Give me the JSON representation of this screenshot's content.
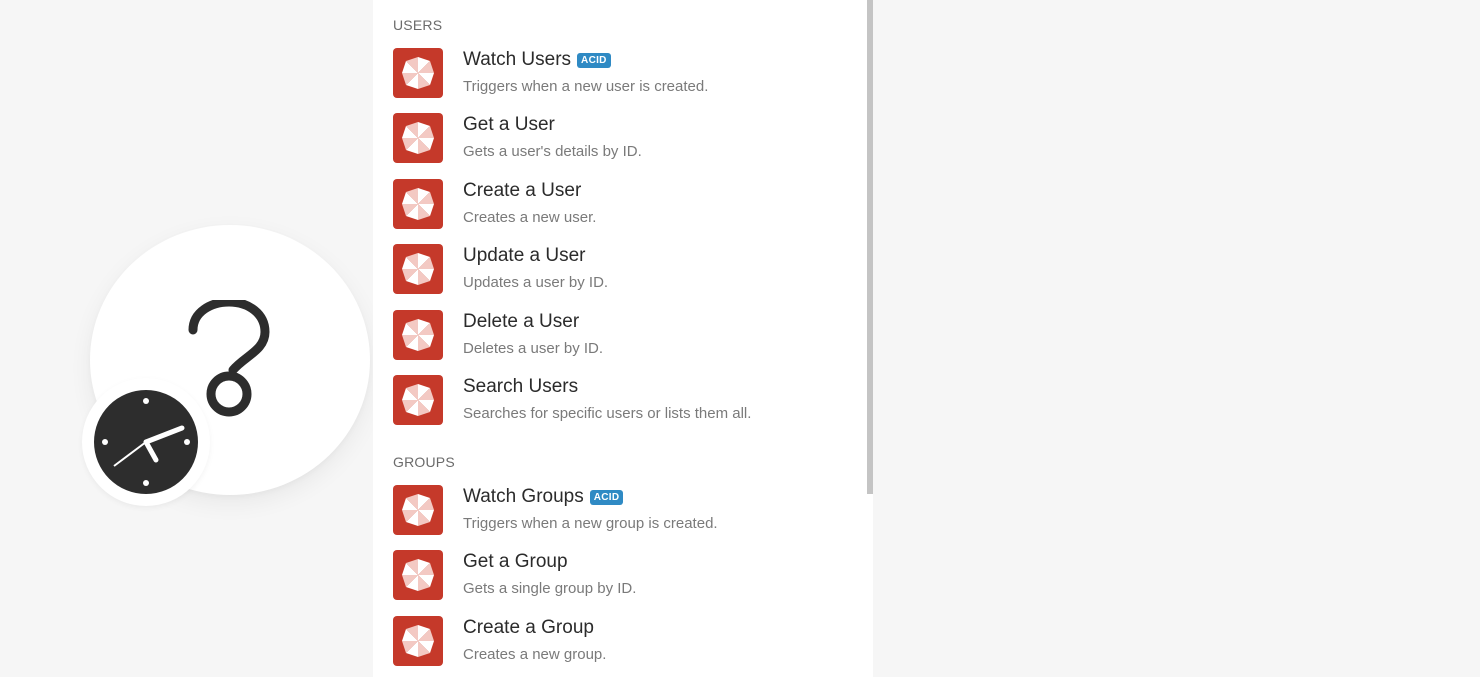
{
  "module": {
    "icon": "question-mark-icon",
    "badge_icon": "clock-icon"
  },
  "sections": {
    "users": {
      "header": "USERS",
      "items": [
        {
          "title": "Watch Users",
          "badge": "ACID",
          "desc": "Triggers when a new user is created."
        },
        {
          "title": "Get a User",
          "desc": "Gets a user's details by ID."
        },
        {
          "title": "Create a User",
          "desc": "Creates a new user."
        },
        {
          "title": "Update a User",
          "desc": "Updates a user by ID."
        },
        {
          "title": "Delete a User",
          "desc": "Deletes a user by ID."
        },
        {
          "title": "Search Users",
          "desc": "Searches for specific users or lists them all."
        }
      ]
    },
    "groups": {
      "header": "GROUPS",
      "items": [
        {
          "title": "Watch Groups",
          "badge": "ACID",
          "desc": "Triggers when a new group is created."
        },
        {
          "title": "Get a Group",
          "desc": "Gets a single group by ID."
        },
        {
          "title": "Create a Group",
          "desc": "Creates a new group."
        }
      ]
    }
  },
  "colors": {
    "app_icon_bg": "#c5392a",
    "badge_bg": "#2f8ac4",
    "clock_bg": "#2d2d2d"
  }
}
